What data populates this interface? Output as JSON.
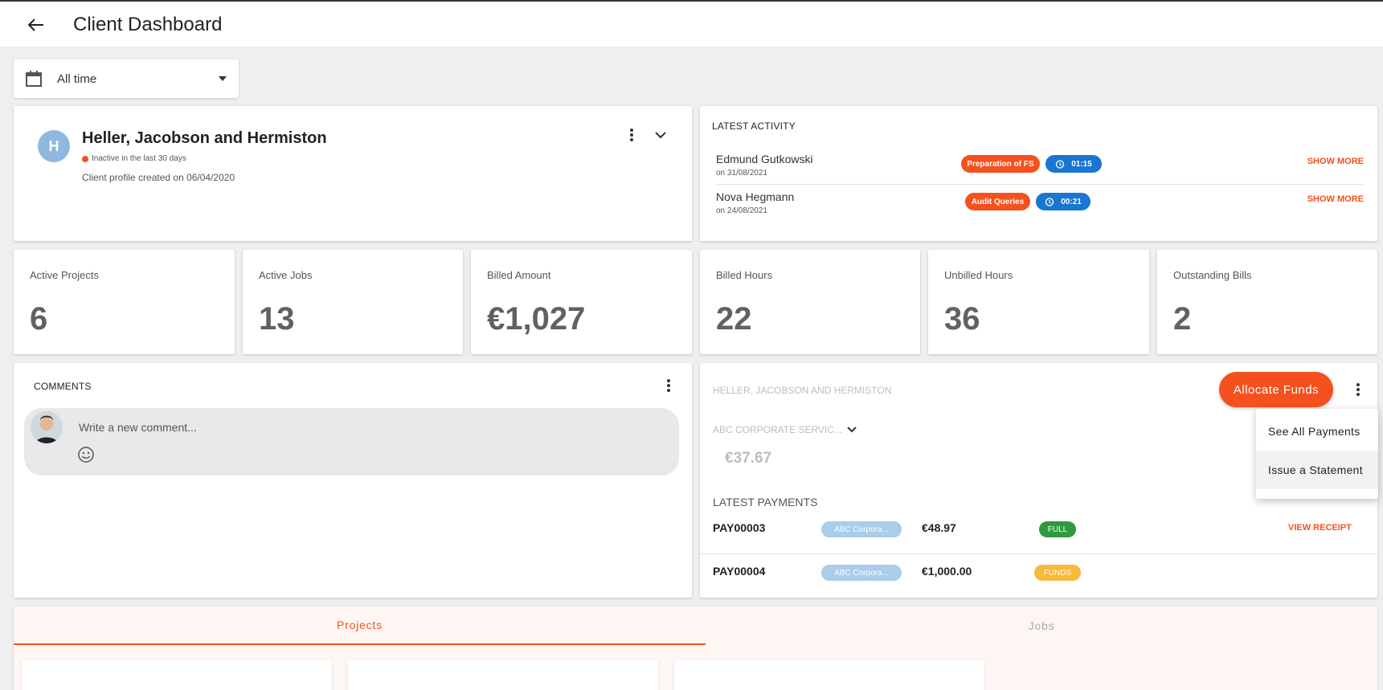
{
  "header": {
    "title": "Client Dashboard"
  },
  "filter": {
    "date_range": "All time"
  },
  "client": {
    "initial": "H",
    "name": "Heller, Jacobson and Hermiston",
    "status": "Inactive in the last 30 days",
    "created": "Client profile created on 06/04/2020"
  },
  "activity": {
    "title": "LATEST ACTIVITY",
    "show_more": "SHOW MORE",
    "items": [
      {
        "name": "Edmund Gutkowski",
        "date": "on 31/08/2021",
        "task": "Preparation of FS",
        "time": "01:15"
      },
      {
        "name": "Nova Hegmann",
        "date": "on 24/08/2021",
        "task": "Audit Queries",
        "time": "00:21"
      }
    ]
  },
  "stats": [
    {
      "label": "Active Projects",
      "value": "6"
    },
    {
      "label": "Active Jobs",
      "value": "13"
    },
    {
      "label": "Billed Amount",
      "value": "€1,027"
    },
    {
      "label": "Billed Hours",
      "value": "22"
    },
    {
      "label": "Unbilled Hours",
      "value": "36"
    },
    {
      "label": "Outstanding Bills",
      "value": "2"
    }
  ],
  "comments": {
    "title": "COMMENTS",
    "placeholder": "Write a new comment..."
  },
  "payments": {
    "client": "HELLER, JACOBSON AND HERMISTON",
    "allocate_label": "Allocate Funds",
    "account": "ABC CORPORATE SERVIC...",
    "balance": "€37.67",
    "latest_title": "LATEST PAYMENTS",
    "view_receipt": "VIEW RECEIPT",
    "rows": [
      {
        "id": "PAY00003",
        "account": "ABC Corpora...",
        "amount": "€48.97",
        "status": "FULL",
        "status_color": "#2e9a3e"
      },
      {
        "id": "PAY00004",
        "account": "ABC Corpora...",
        "amount": "€1,000.00",
        "status": "FUNDS",
        "status_color": "#f6b93b"
      }
    ]
  },
  "menu": {
    "items": [
      "See All Payments",
      "Issue a Statement"
    ]
  },
  "tabs": [
    "Projects",
    "Jobs"
  ],
  "colors": {
    "accent": "#f4511e",
    "blue": "#1976d2",
    "avatar": "#8fb8df"
  }
}
